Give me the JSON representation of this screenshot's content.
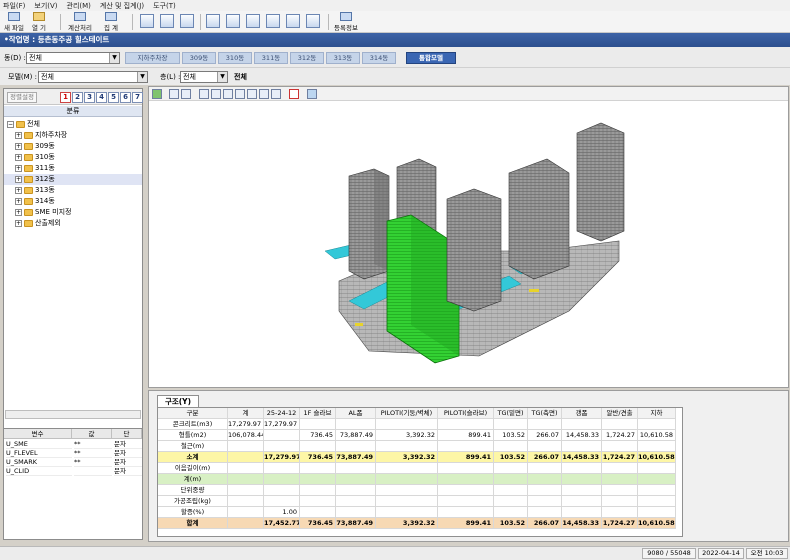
{
  "menu": [
    "파일(F)",
    "보기(V)",
    "관리(M)",
    "계산 및 집계(J)",
    "도구(T)"
  ],
  "toolbar": {
    "new_label": "새 파일",
    "open_label": "열 기",
    "calc_label": "계산처리",
    "sum_label": "집 계",
    "register_label": "등록정보"
  },
  "title": "•작업명 : 등촌동주공 힐스테이트",
  "dong": {
    "label": "동(D) :",
    "value": "전체",
    "tabs": [
      "지하주차장",
      "309동",
      "310동",
      "311동",
      "312동",
      "313동",
      "314동",
      "통합모델"
    ],
    "active_tab": 7
  },
  "model": {
    "label": "모델(M) :",
    "value": "전체",
    "floor_label": "층(L) :",
    "floor_value": "전체",
    "floor_text": "전체"
  },
  "lefttools": {
    "sort_label": "정렬설정",
    "nums": [
      "1",
      "2",
      "3",
      "4",
      "5",
      "6",
      "7"
    ]
  },
  "tree": {
    "header": "분류",
    "root": "전체",
    "items": [
      "지하주차장",
      "309동",
      "310동",
      "311동",
      "312동",
      "313동",
      "314동",
      "SME 미지정",
      "산출제외"
    ],
    "selected": 4
  },
  "vars": {
    "headers": [
      "변수",
      "값",
      "단"
    ],
    "rows": [
      {
        "name": "U_SME",
        "value": "**",
        "unit": "문자"
      },
      {
        "name": "U_FLEVEL",
        "value": "**",
        "unit": "문자"
      },
      {
        "name": "U_SMARK",
        "value": "**",
        "unit": "문자"
      },
      {
        "name": "U_CLID",
        "value": "",
        "unit": "문자"
      }
    ]
  },
  "bottom": {
    "tab": "구조(Y)",
    "headers": [
      "구분",
      "계",
      "25-24-12",
      "1F 슬라브",
      "AL폼",
      "PILOTI(기둥/벽체)",
      "PILOTI(슬라브)",
      "TG(밑면)",
      "TG(측면)",
      "갱폼",
      "알반/견출",
      "지하"
    ],
    "rows": [
      {
        "cells": [
          "콘크리트(m3)",
          "17,279.97",
          "17,279.97",
          "",
          "",
          "",
          "",
          "",
          "",
          "",
          "",
          ""
        ],
        "style": "normal"
      },
      {
        "cells": [
          "형틀(m2)",
          "106,078.44",
          "",
          "736.45",
          "73,887.49",
          "3,392.32",
          "899.41",
          "103.52",
          "266.07",
          "14,458.33",
          "1,724.27",
          "10,610.58"
        ],
        "style": "normal"
      },
      {
        "cells": [
          "철근(m)",
          "",
          "",
          "",
          "",
          "",
          "",
          "",
          "",
          "",
          "",
          ""
        ],
        "style": "normal"
      },
      {
        "cells": [
          "소계",
          "",
          "17,279.97",
          "736.45",
          "73,887.49",
          "3,392.32",
          "899.41",
          "103.52",
          "266.07",
          "14,458.33",
          "1,724.27",
          "10,610.58"
        ],
        "style": "yellow"
      },
      {
        "cells": [
          "이음길이(m)",
          "",
          "",
          "",
          "",
          "",
          "",
          "",
          "",
          "",
          "",
          ""
        ],
        "style": "normal"
      },
      {
        "cells": [
          "계(m)",
          "",
          "",
          "",
          "",
          "",
          "",
          "",
          "",
          "",
          "",
          ""
        ],
        "style": "green"
      },
      {
        "cells": [
          "단위중량",
          "",
          "",
          "",
          "",
          "",
          "",
          "",
          "",
          "",
          "",
          ""
        ],
        "style": "normal"
      },
      {
        "cells": [
          "가공조립(kg)",
          "",
          "",
          "",
          "",
          "",
          "",
          "",
          "",
          "",
          "",
          ""
        ],
        "style": "normal"
      },
      {
        "cells": [
          "할증(%)",
          "",
          "1.00",
          "",
          "",
          "",
          "",
          "",
          "",
          "",
          "",
          ""
        ],
        "style": "normal"
      },
      {
        "cells": [
          "합계",
          "",
          "17,452.77",
          "736.45",
          "73,887.49",
          "3,392.32",
          "899.41",
          "103.52",
          "266.07",
          "14,458.33",
          "1,724.27",
          "10,610.58"
        ],
        "style": "orange"
      }
    ]
  },
  "status": {
    "count": "9080 / 55048",
    "date": "2022-04-14",
    "time": "오전 10:03"
  },
  "colors": {
    "title_blue": "#2c4f8e",
    "highlight_green": "#2fd12f",
    "water_cyan": "#33c8d8",
    "row_yellow": "#fdf6a6",
    "row_orange": "#f7d9b4",
    "row_green": "#d8f0c4"
  }
}
